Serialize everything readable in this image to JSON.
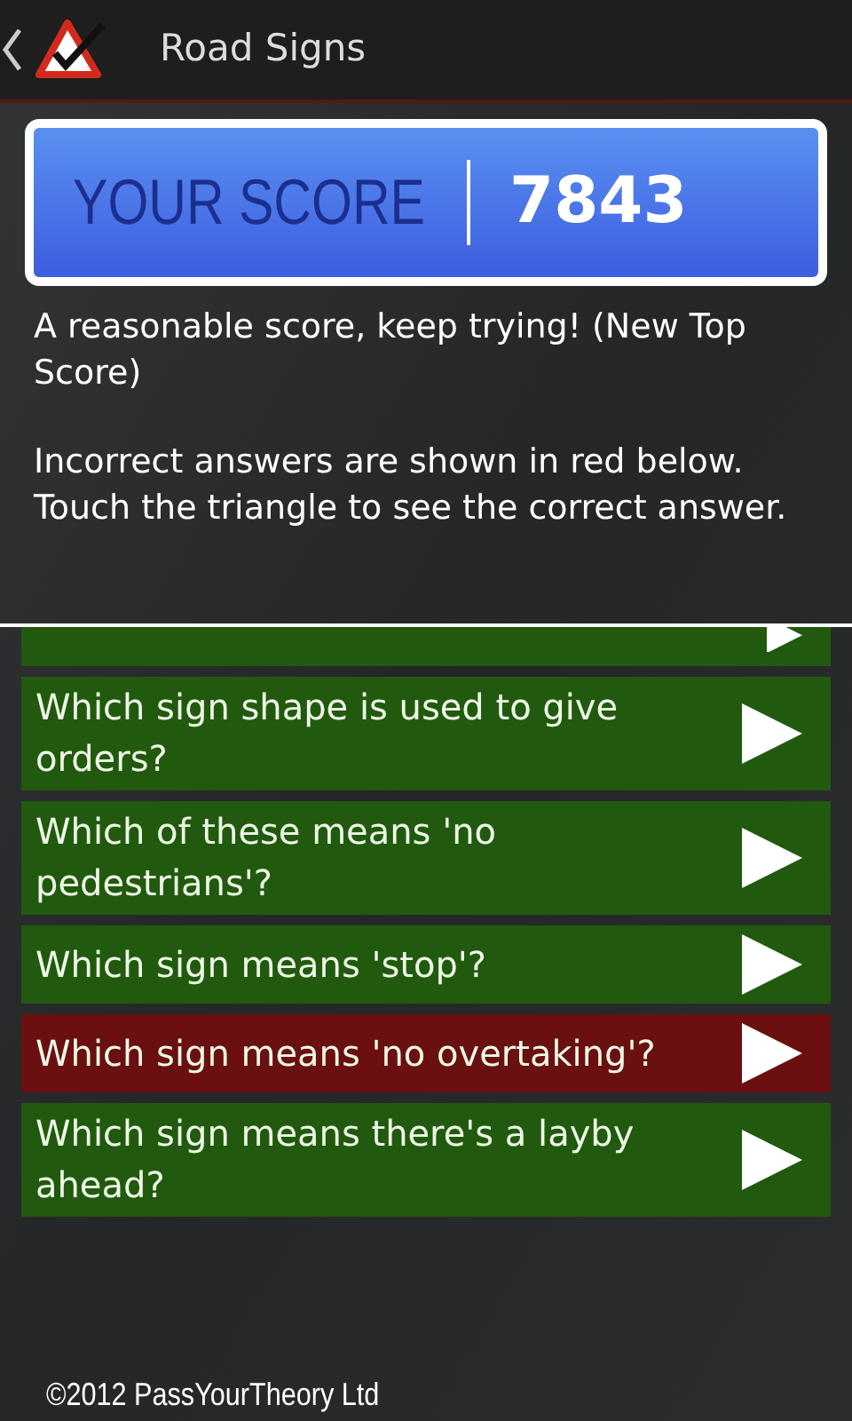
{
  "header": {
    "title": "Road Signs"
  },
  "score": {
    "label": "YOUR SCORE",
    "value": "7843"
  },
  "messages": [
    "A reasonable score, keep trying! (New Top Score)",
    "Incorrect answers are shown in red below. Touch the triangle to see the correct answer."
  ],
  "questions": [
    {
      "text": "Which sign shape is used to give orders?",
      "correct": true
    },
    {
      "text": "Which of these means 'no pedestrians'?",
      "correct": true
    },
    {
      "text": "Which sign means 'stop'?",
      "correct": true
    },
    {
      "text": "Which sign means 'no overtaking'?",
      "correct": false
    },
    {
      "text": "Which sign means there's a layby ahead?",
      "correct": true
    }
  ],
  "footer": "©2012 PassYourTheory Ltd"
}
